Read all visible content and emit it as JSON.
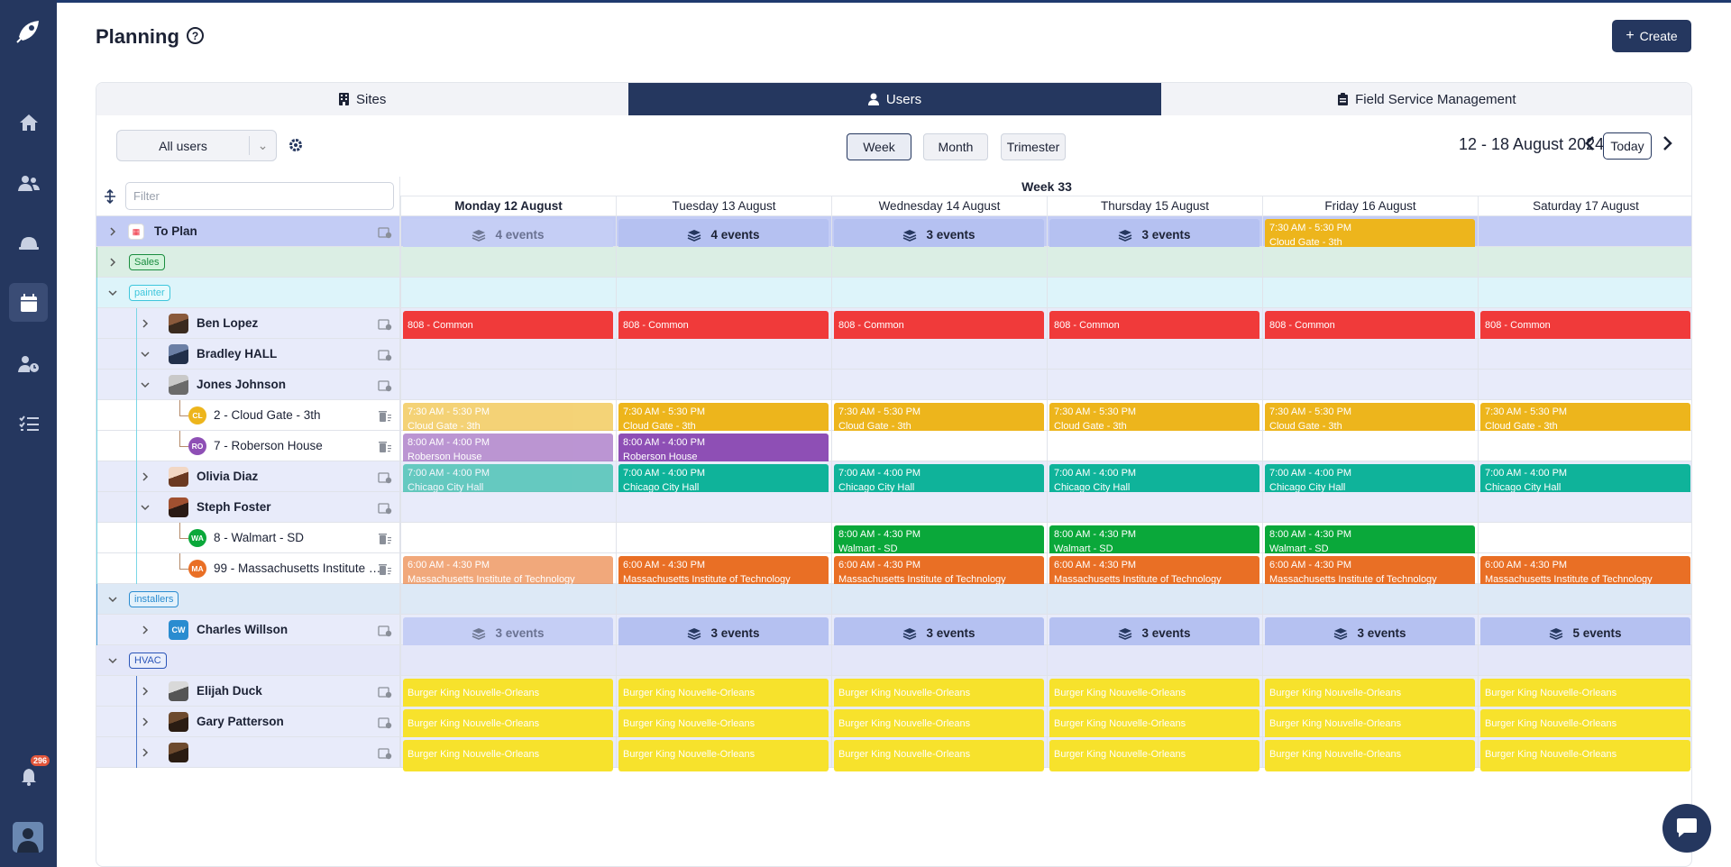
{
  "header": {
    "title": "Planning",
    "help_label": "?",
    "create_label": "Create"
  },
  "tabs": [
    {
      "label": "Sites"
    },
    {
      "label": "Users"
    },
    {
      "label": "Field Service Management"
    }
  ],
  "toolbar": {
    "user_filter": "All users",
    "views": [
      "Week",
      "Month",
      "Trimester"
    ],
    "active_view": "Week",
    "range": "12 - 18 August 2024",
    "today_label": "Today"
  },
  "grid": {
    "filter_placeholder": "Filter",
    "week_label": "Week 33",
    "days": [
      "Monday 12 August",
      "Tuesday 13 August",
      "Wednesday 14 August",
      "Thursday 15 August",
      "Friday 16 August",
      "Saturday 17 August"
    ]
  },
  "rows": {
    "to_plan": {
      "label": "To Plan",
      "counts": [
        "4 events",
        "4 events",
        "3 events",
        "3 events"
      ],
      "friday_time": "7:30 AM - 5:30 PM",
      "friday_site": "Cloud Gate - 3th"
    },
    "groups": {
      "sales": "Sales",
      "painter": "painter",
      "installers": "installers",
      "hvac": "HVAC"
    },
    "users": {
      "ben": "Ben Lopez",
      "bradley": "Bradley HALL",
      "jones": "Jones Johnson",
      "olivia": "Olivia Diaz",
      "steph": "Steph Foster",
      "charles": "Charles Willson",
      "elijah": "Elijah Duck",
      "gary": "Gary Patterson"
    },
    "sites": {
      "cloud": {
        "initials": "CL",
        "label": "2 - Cloud Gate - 3th"
      },
      "roberson": {
        "initials": "RO",
        "label": "7 - Roberson House"
      },
      "walmart": {
        "initials": "WA",
        "label": "8 - Walmart - SD"
      },
      "mit": {
        "initials": "MA",
        "label": "99 - Massachusetts Institute of Technology"
      }
    },
    "charles_initials": "CW",
    "charles_counts": [
      "3 events",
      "3 events",
      "3 events",
      "3 events",
      "3 events",
      "5 events"
    ]
  },
  "events": {
    "common": "808 - Common",
    "cloud_time": "7:30 AM - 5:30 PM",
    "cloud_site": "Cloud Gate - 3th",
    "rob_time": "8:00 AM - 4:00 PM",
    "rob_site": "Roberson House",
    "chi_time": "7:00 AM - 4:00 PM",
    "chi_site": "Chicago City Hall",
    "wal_time": "8:00 AM - 4:30 PM",
    "wal_site": "Walmart - SD",
    "mit_time": "6:00 AM - 4:30 PM",
    "mit_site": "Massachusetts Institute of Technology",
    "bk": "Burger King Nouvelle-Orleans"
  },
  "notifications": {
    "count": "296"
  },
  "colors": {
    "navy": "#25375f",
    "red": "#f03a3a",
    "amber": "#edb51c",
    "purple": "#8e4fb5",
    "teal": "#0fb39a",
    "green": "#0aa83a",
    "orange": "#e96f25",
    "yellow": "#f7e22c",
    "planning_bg": "#c3ccf5"
  }
}
